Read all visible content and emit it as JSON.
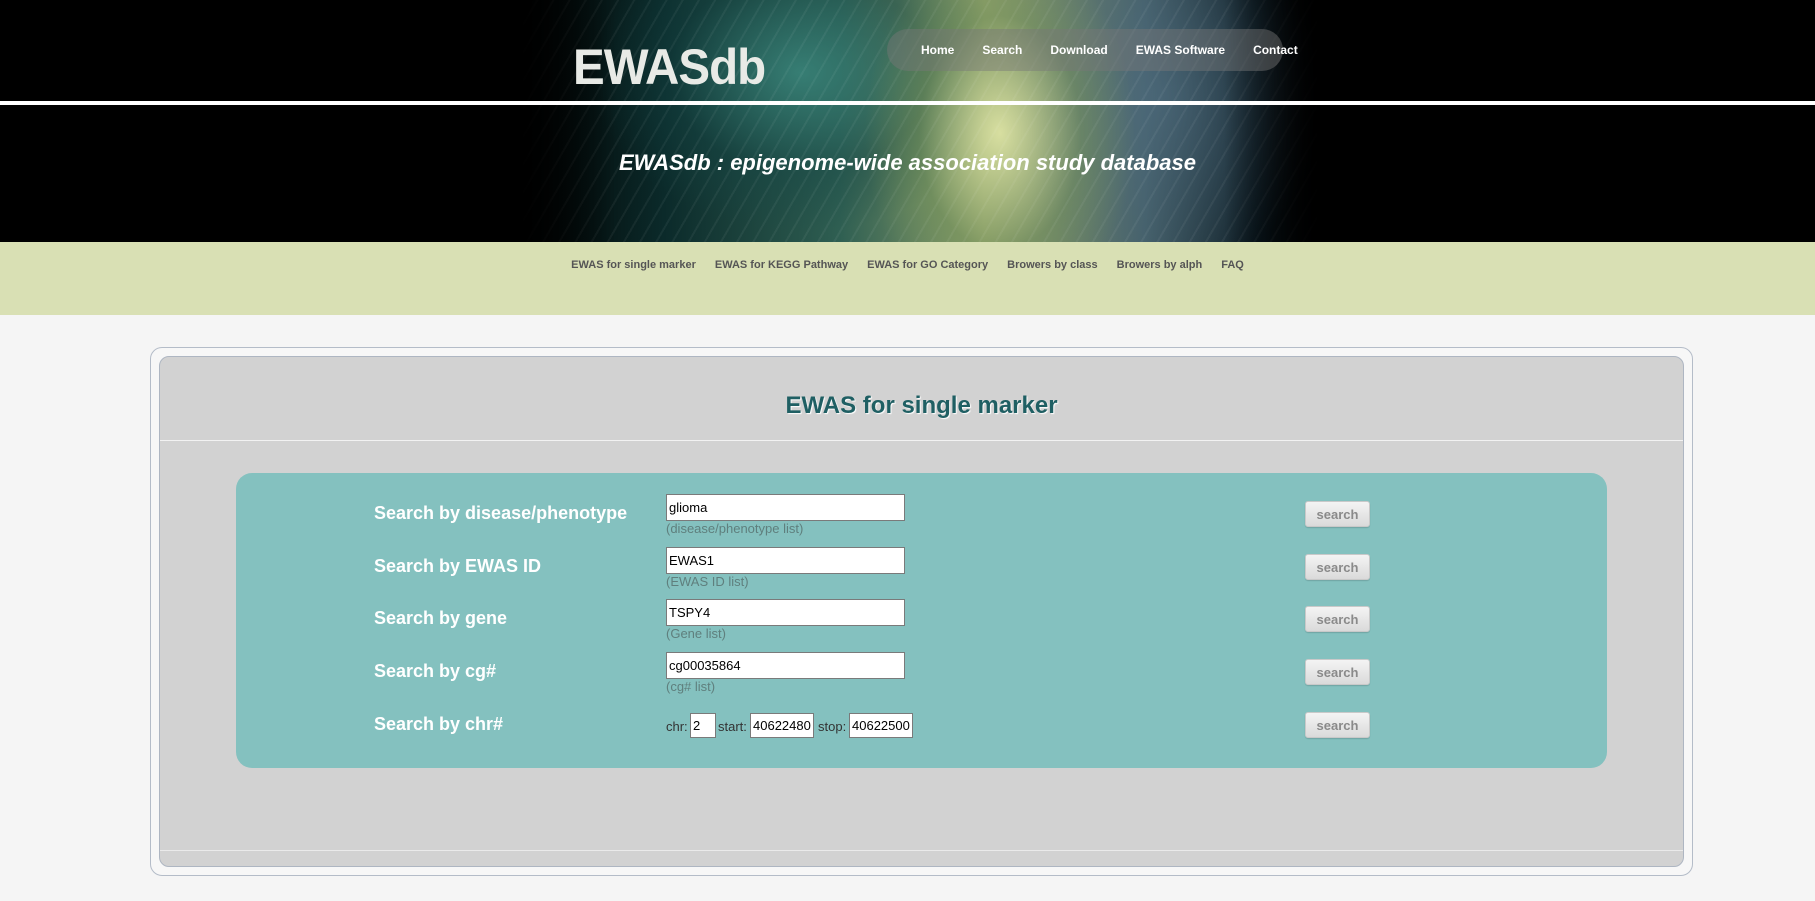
{
  "header": {
    "logo": "EWASdb",
    "nav": [
      "Home",
      "Search",
      "Download",
      "EWAS Software",
      "Contact"
    ],
    "tagline": "EWASdb : epigenome-wide association study database"
  },
  "subnav": [
    "EWAS for single marker",
    "EWAS for KEGG Pathway",
    "EWAS for GO Category",
    "Browers by class",
    "Browers by alph",
    "FAQ"
  ],
  "panel": {
    "title": "EWAS for single marker",
    "rows": [
      {
        "label": "Search by disease/phenotype",
        "value": "glioma",
        "hint": "(disease/phenotype list)",
        "button": "search"
      },
      {
        "label": "Search by EWAS ID",
        "value": "EWAS1",
        "hint": "(EWAS ID list)",
        "button": "search"
      },
      {
        "label": "Search by gene",
        "value": "TSPY4",
        "hint": "(Gene list)",
        "button": "search"
      },
      {
        "label": "Search by cg#",
        "value": "cg00035864",
        "hint": "(cg# list)",
        "button": "search"
      }
    ],
    "chr_row": {
      "label": "Search by chr#",
      "chr_label": "chr:",
      "chr_value": "2",
      "start_label": "start:",
      "start_value": "40622480",
      "stop_label": "stop:",
      "stop_value": "40622500",
      "button": "search"
    }
  },
  "colors": {
    "subnav_bg": "#d9e0b4",
    "search_box_bg": "#84c1bf",
    "title_color": "#1f5f63"
  }
}
